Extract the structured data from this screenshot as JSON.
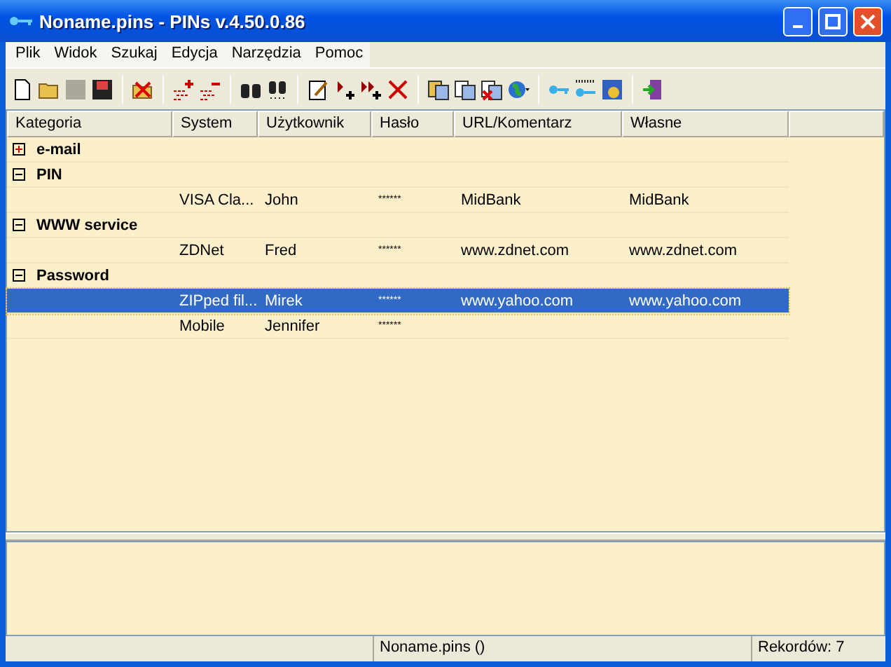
{
  "window": {
    "title": "Noname.pins - PINs v.4.50.0.86"
  },
  "menu": [
    "Plik",
    "Widok",
    "Szukaj",
    "Edycja",
    "Narzędzia",
    "Pomoc"
  ],
  "table": {
    "columns": [
      "Kategoria",
      "System",
      "Użytkownik",
      "Hasło",
      "URL/Komentarz",
      "Własne"
    ],
    "groups": [
      {
        "name": "e-mail",
        "expanded": false
      },
      {
        "name": "PIN",
        "expanded": true,
        "rows": [
          {
            "cells": [
              "VISA Cla...",
              "John",
              "******",
              "MidBank",
              "MidBank"
            ],
            "selected": false
          }
        ]
      },
      {
        "name": "WWW service",
        "expanded": true,
        "rows": [
          {
            "cells": [
              "ZDNet",
              "Fred",
              "******",
              "www.zdnet.com",
              "www.zdnet.com"
            ],
            "selected": false
          }
        ]
      },
      {
        "name": "Password",
        "expanded": true,
        "rows": [
          {
            "cells": [
              "ZIPped fil...",
              "Mirek",
              "******",
              "www.yahoo.com",
              "www.yahoo.com"
            ],
            "selected": true
          },
          {
            "cells": [
              "Mobile",
              "Jennifer",
              "******"
            ],
            "selected": false
          }
        ]
      }
    ]
  },
  "status_bar": [
    "Noname.pins ()",
    "Rekordów: 7"
  ]
}
